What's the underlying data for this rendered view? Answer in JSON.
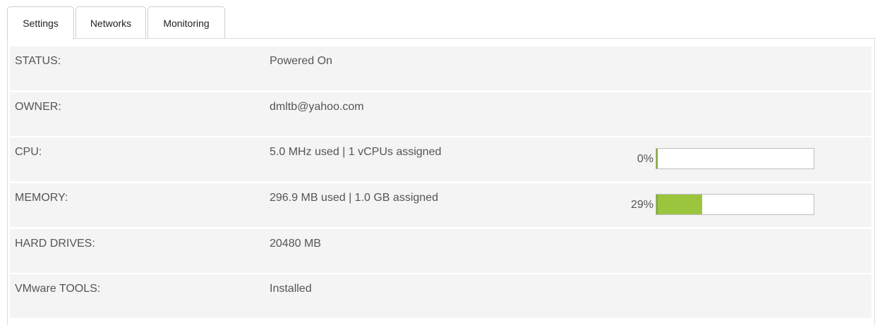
{
  "tabs": [
    {
      "label": "Settings",
      "active": true
    },
    {
      "label": "Networks",
      "active": false
    },
    {
      "label": "Monitoring",
      "active": false
    }
  ],
  "rows": {
    "status": {
      "label": "STATUS:",
      "value": "Powered On"
    },
    "owner": {
      "label": "OWNER:",
      "value": "dmltb@yahoo.com"
    },
    "cpu": {
      "label": "CPU:",
      "value": "5.0 MHz used | 1 vCPUs assigned",
      "percent_label": "0%",
      "percent": 0
    },
    "memory": {
      "label": "MEMORY:",
      "value": "296.9 MB used | 1.0 GB assigned",
      "percent_label": "29%",
      "percent": 29
    },
    "hard_drives": {
      "label": "HARD DRIVES:",
      "value": "20480 MB"
    },
    "vmware_tools": {
      "label": "VMware TOOLS:",
      "value": "Installed"
    }
  },
  "colors": {
    "bar_fill": "#9bc53d",
    "row_background": "#f4f4f4"
  }
}
